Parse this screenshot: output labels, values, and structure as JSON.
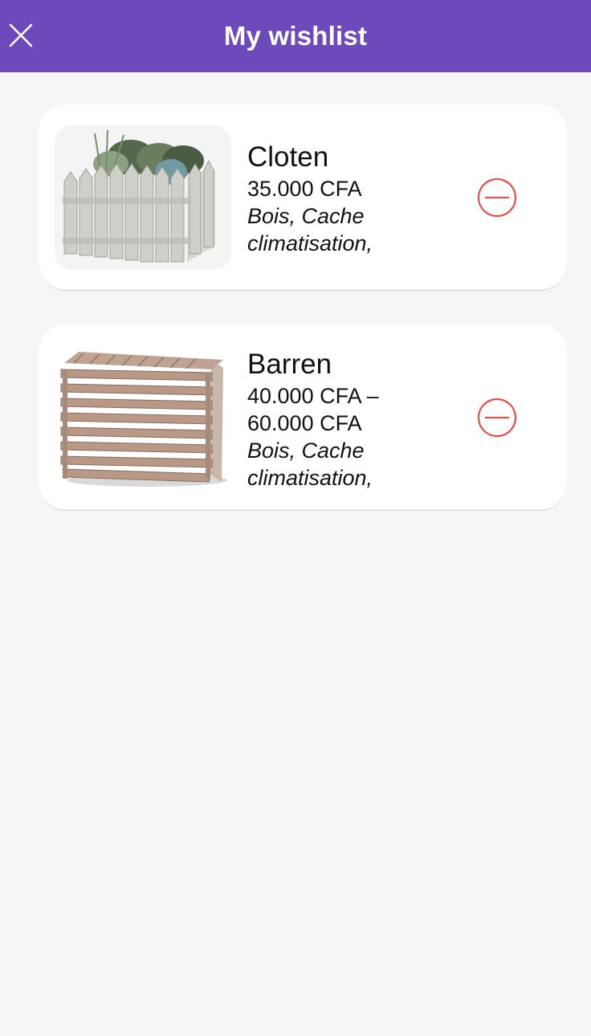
{
  "header": {
    "title": "My wishlist",
    "close_icon": "close-icon",
    "background": "#6d4abb"
  },
  "wishlist": {
    "items": [
      {
        "name": "Cloten",
        "price": "35.000 CFA",
        "categories": "Bois, Cache climatisation,",
        "image": "picket-fence-planter",
        "remove_icon": "minus-circle-icon"
      },
      {
        "name": "Barren",
        "price": "40.000 CFA – 60.000 CFA",
        "categories": "Bois, Cache climatisation,",
        "image": "slatted-ac-cover",
        "remove_icon": "minus-circle-icon"
      }
    ]
  },
  "colors": {
    "accent": "#6d4abb",
    "remove": "#e0504d",
    "background": "#f7f5f6"
  }
}
